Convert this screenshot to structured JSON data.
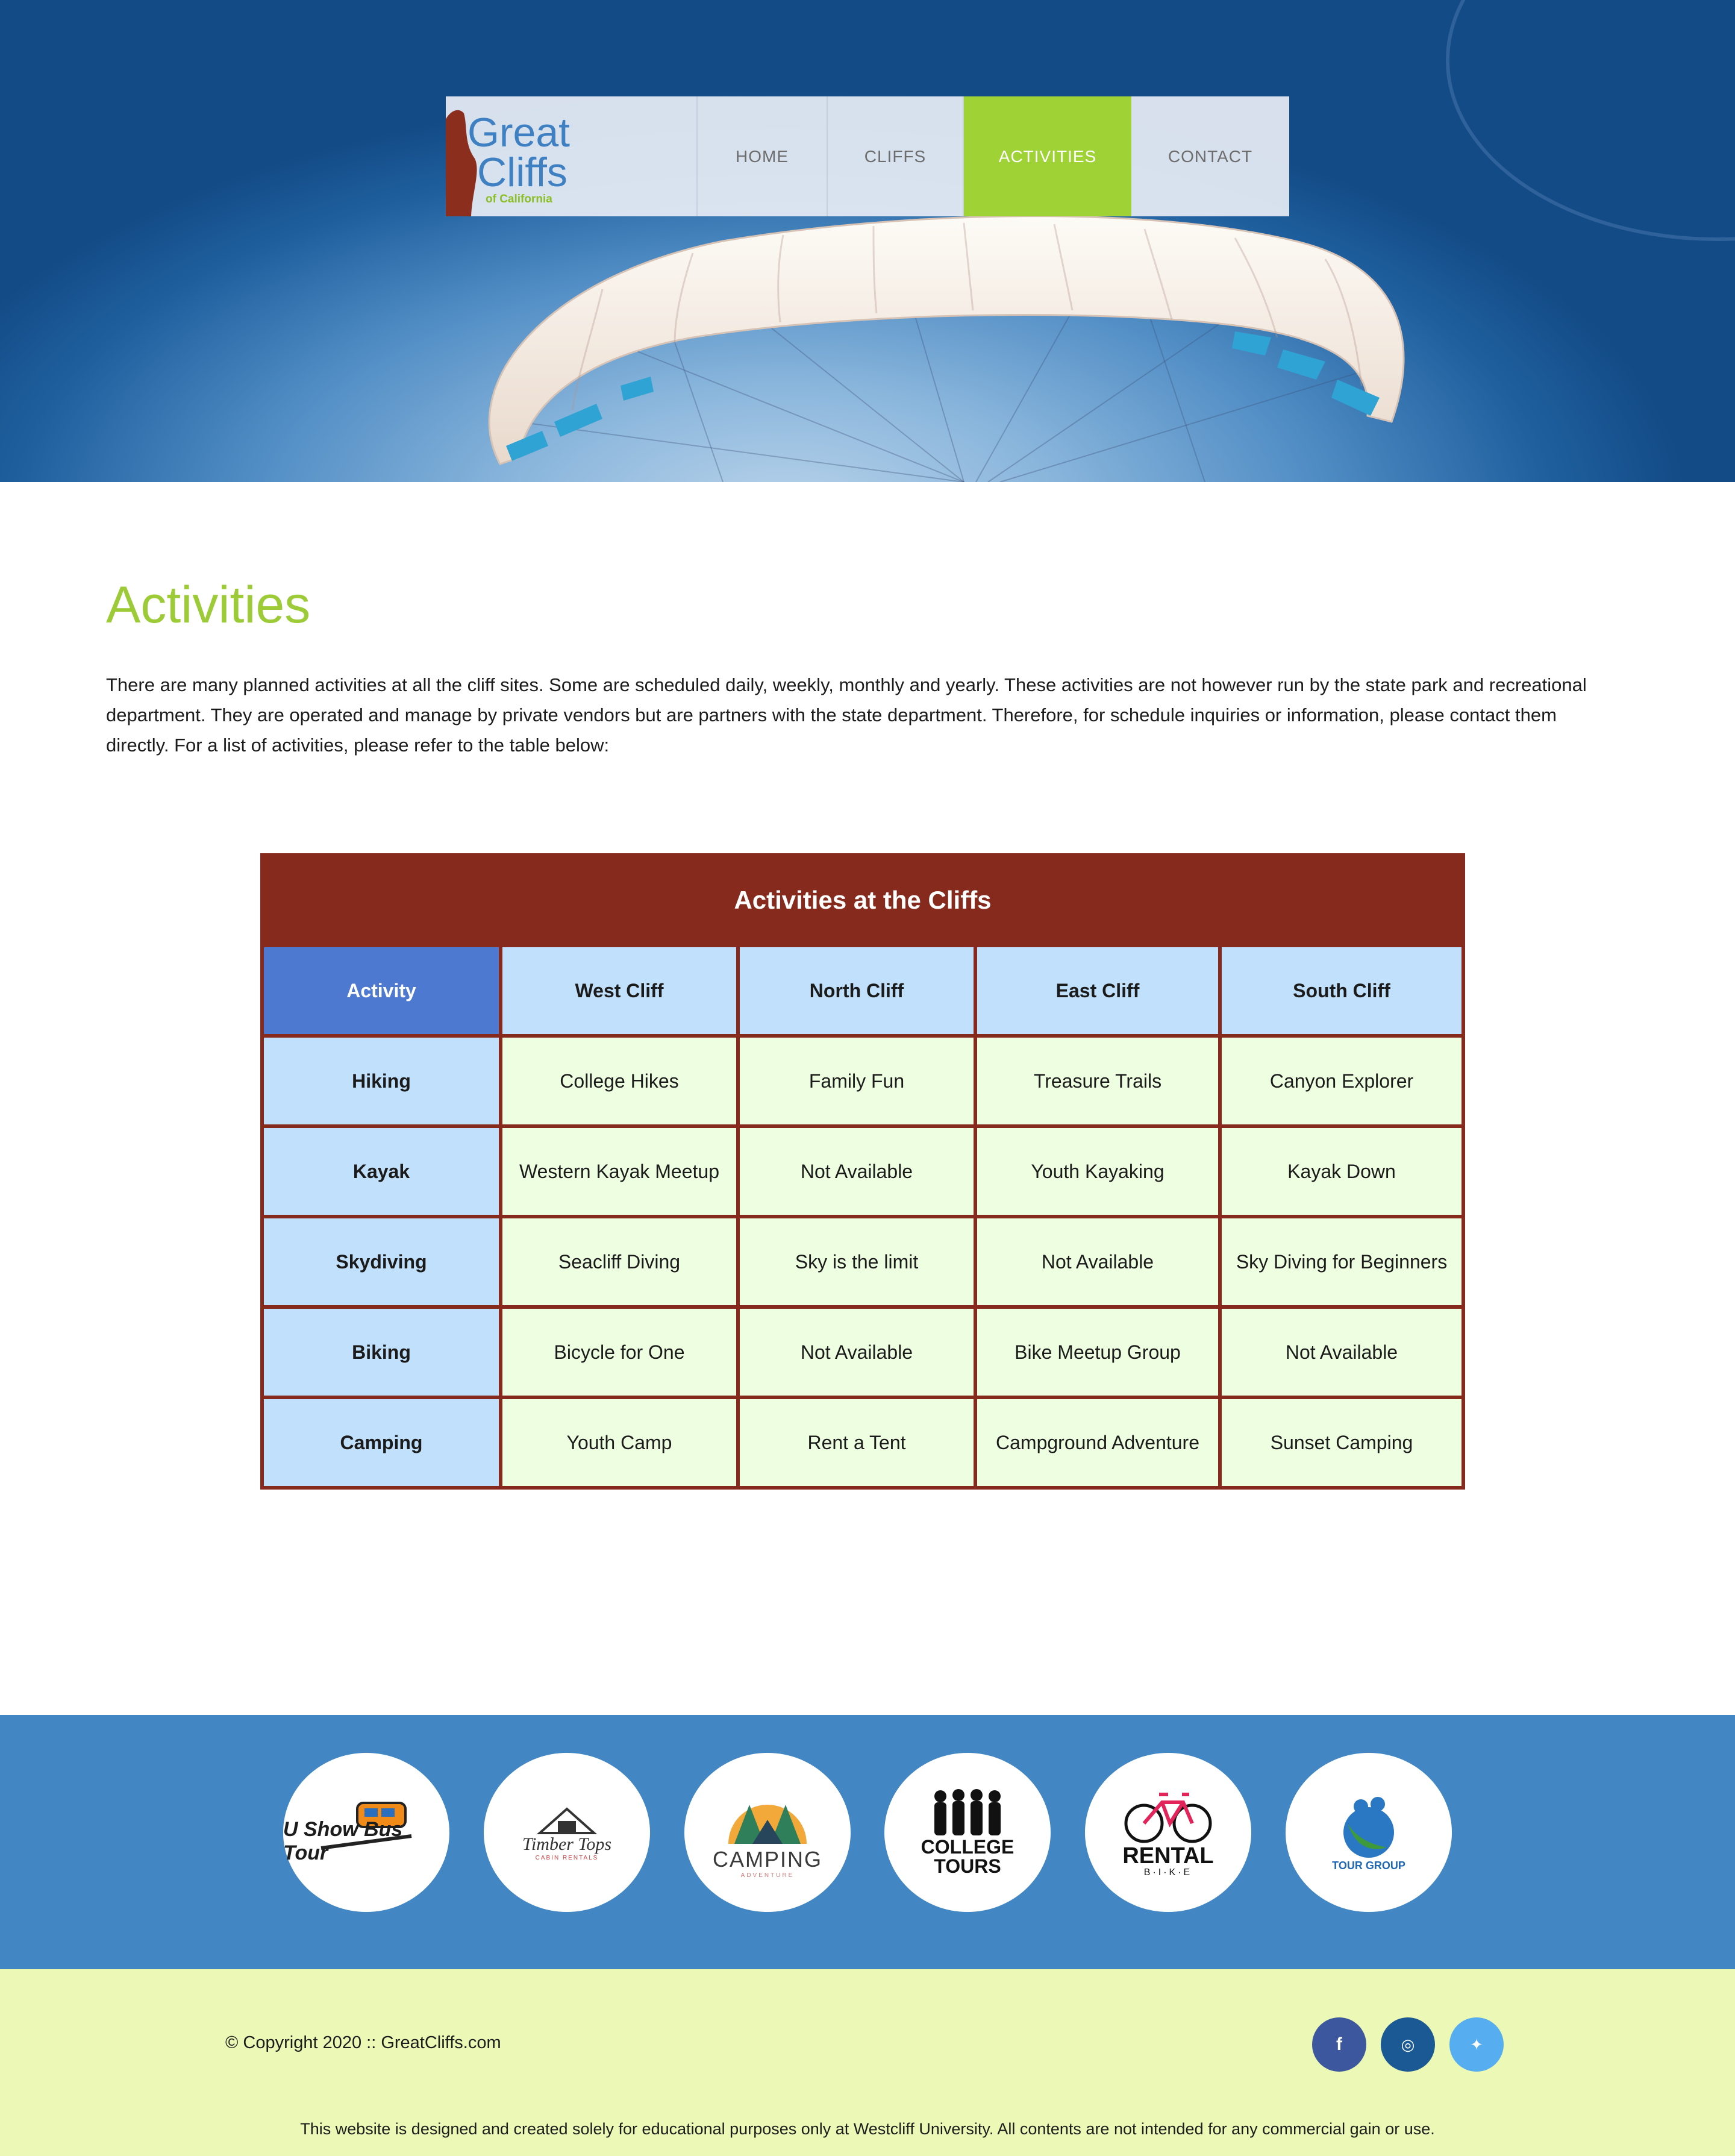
{
  "site": {
    "logo": {
      "line1": "Great",
      "line2": "Cliffs",
      "line3": "of California"
    },
    "nav": [
      {
        "label": "HOME"
      },
      {
        "label": "CLIFFS"
      },
      {
        "label": "ACTIVITIES",
        "active": true
      },
      {
        "label": "CONTACT"
      }
    ]
  },
  "main": {
    "title": "Activities",
    "intro": "There are many planned activities at all the cliff sites. Some are scheduled daily, weekly, monthly and yearly. These activities are not however run by the state park and recreational department. They are operated and manage by private vendors but are partners with the state department. Therefore, for schedule inquiries or information, please contact them directly. For a list of activities, please refer to the table below:"
  },
  "table": {
    "caption": "Activities at the Cliffs",
    "headers": [
      "Activity",
      "West Cliff",
      "North Cliff",
      "East Cliff",
      "South Cliff"
    ],
    "rows": [
      [
        "Hiking",
        "College Hikes",
        "Family Fun",
        "Treasure Trails",
        "Canyon Explorer"
      ],
      [
        "Kayak",
        "Western Kayak Meetup",
        "Not Available",
        "Youth Kayaking",
        "Kayak Down"
      ],
      [
        "Skydiving",
        "Seacliff Diving",
        "Sky is the limit",
        "Not Available",
        "Sky Diving for Beginners"
      ],
      [
        "Biking",
        "Bicycle for One",
        "Not Available",
        "Bike Meetup Group",
        "Not Available"
      ],
      [
        "Camping",
        "Youth Camp",
        "Rent a Tent",
        "Campground Adventure",
        "Sunset Camping"
      ]
    ]
  },
  "partners": [
    {
      "name": "bus-tour-logo",
      "text": "U Show Bus Tour"
    },
    {
      "name": "timber-tops-logo",
      "text": "Timber Tops",
      "sub": "CABIN RENTALS"
    },
    {
      "name": "camping-logo",
      "text": "CAMPING",
      "sub": "ADVENTURE"
    },
    {
      "name": "college-tours-logo",
      "text": "COLLEGE",
      "sub": "TOURS"
    },
    {
      "name": "rental-bike-logo",
      "text": "RENTAL",
      "sub": "B·I·K·E"
    },
    {
      "name": "tour-group-logo",
      "text": "TOUR GROUP"
    }
  ],
  "footer": {
    "copyright": "© Copyright 2020 :: GreatCliffs.com",
    "disclaimer": "This website is designed and created solely for educational purposes only at Westcliff University. All contents are not intended for any commercial gain or use.",
    "social": [
      {
        "icon": "facebook-icon",
        "glyph": "f"
      },
      {
        "icon": "instagram-icon",
        "glyph": "◎"
      },
      {
        "icon": "twitter-icon",
        "glyph": "✦"
      }
    ]
  },
  "colors": {
    "accent_green": "#9fd235",
    "table_border": "#862a1e",
    "header_blue": "#4e79d1",
    "partners_bg": "#4287c3",
    "footer_bg": "#ebf8b6"
  }
}
